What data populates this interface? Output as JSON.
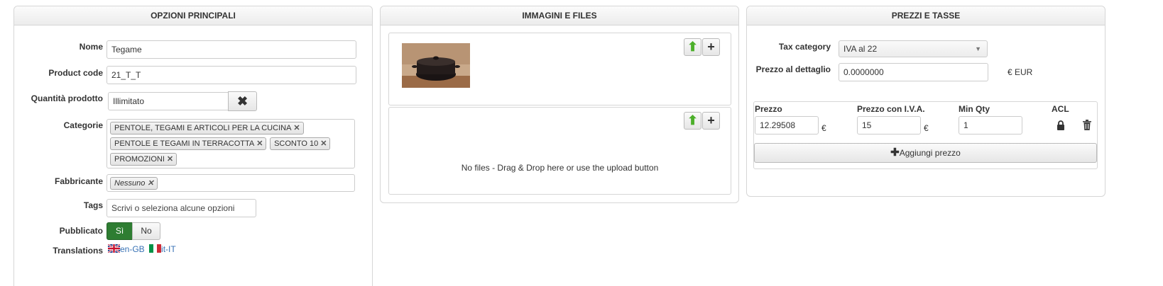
{
  "main": {
    "title": "OPZIONI PRINCIPALI",
    "name_label": "Nome",
    "name_value": "Tegame",
    "code_label": "Product code",
    "code_value": "21_T_T",
    "qty_label": "Quantità prodotto",
    "qty_value": "Illimitato",
    "categories_label": "Categorie",
    "categories": [
      "PENTOLE, TEGAMI E ARTICOLI PER LA CUCINA",
      "PENTOLE E TEGAMI IN TERRACOTTA",
      "SCONTO 10",
      "PROMOZIONI"
    ],
    "manufacturer_label": "Fabbricante",
    "manufacturer_value": "Nessuno",
    "tags_label": "Tags",
    "tags_placeholder": "Scrivi o seleziona alcune opzioni",
    "published_label": "Pubblicato",
    "published_yes": "Sì",
    "published_no": "No",
    "translations_label": "Translations",
    "translations": [
      "en-GB",
      "it-IT"
    ]
  },
  "images": {
    "title": "IMMAGINI E FILES",
    "no_files_text": "No files - Drag & Drop here or use the upload button"
  },
  "prices": {
    "title": "PREZZI E TASSE",
    "tax_label": "Tax category",
    "tax_value": "IVA al 22",
    "retail_label": "Prezzo al dettaglio",
    "retail_value": "0.0000000",
    "currency": "€ EUR",
    "col_price": "Prezzo",
    "col_price_vat": "Prezzo con I.V.A.",
    "col_min_qty": "Min Qty",
    "col_acl": "ACL",
    "row_price": "12.29508",
    "row_price_vat": "15",
    "row_min_qty": "1",
    "euro_symbol": "€",
    "add_price_label": "Aggiungi prezzo"
  },
  "colors": {
    "accent_green": "#2e7d32",
    "link_blue": "#3872b5",
    "upload_green": "#4caf2a"
  }
}
